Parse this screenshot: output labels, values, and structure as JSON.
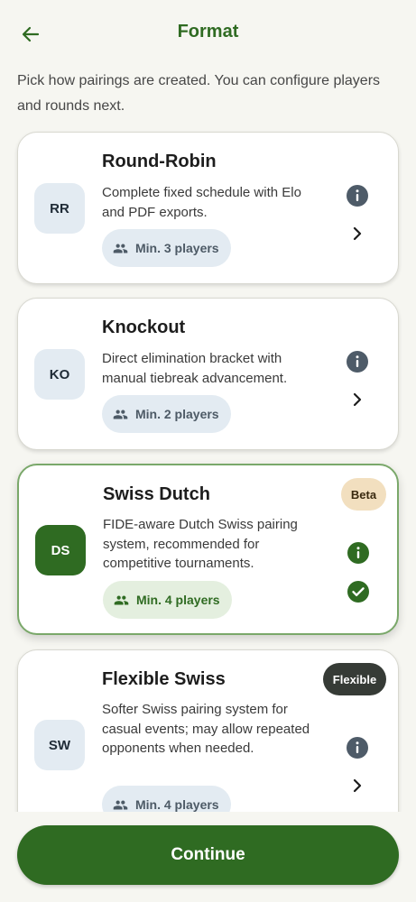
{
  "header": {
    "title": "Format"
  },
  "subtitle": "Pick how pairings are created. You can configure players and rounds next.",
  "formats": [
    {
      "abbr": "RR",
      "title": "Round-Robin",
      "description": "Complete fixed schedule with Elo and PDF exports.",
      "min_players": "Min. 3 players",
      "selected": false,
      "tag": null
    },
    {
      "abbr": "KO",
      "title": "Knockout",
      "description": "Direct elimination bracket with manual tiebreak advancement.",
      "min_players": "Min. 2 players",
      "selected": false,
      "tag": null
    },
    {
      "abbr": "DS",
      "title": "Swiss Dutch",
      "description": "FIDE-aware Dutch Swiss pairing system, recommended for competitive tournaments.",
      "min_players": "Min. 4 players",
      "selected": true,
      "tag": "Beta"
    },
    {
      "abbr": "SW",
      "title": "Flexible Swiss",
      "description": "Softer Swiss pairing system for casual events; may allow repeated opponents when needed.",
      "min_players": "Min. 4 players",
      "selected": false,
      "tag": "Flexible"
    }
  ],
  "footer": {
    "continue_label": "Continue"
  },
  "colors": {
    "primary": "#2f6b22",
    "background": "#f6f6f1",
    "abbr_bg": "#e3ebf2",
    "info_icon": "#4e5b68",
    "beta_tag": "#f2dfbf",
    "flexible_tag": "#363b36"
  },
  "icons": {
    "back": "arrow-left-icon",
    "info": "info-icon",
    "chevron": "chevron-right-icon",
    "selected": "check-circle-icon",
    "players": "people-icon"
  }
}
